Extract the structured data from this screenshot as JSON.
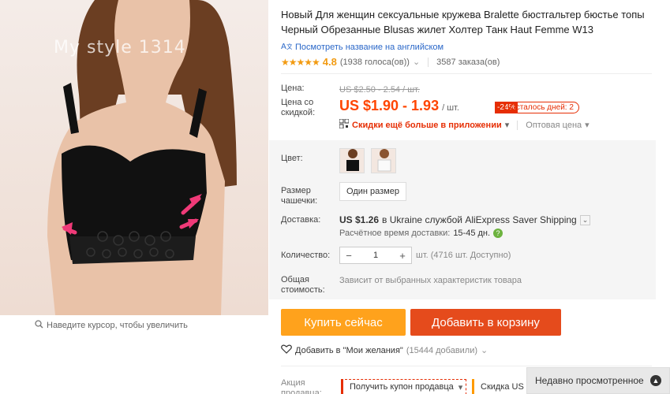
{
  "gallery": {
    "watermark": "My style 1314",
    "zoom_hint": "Наведите курсор, чтобы увеличить"
  },
  "product": {
    "title": "Новый Для женщин сексуальные кружева Bralette бюстгальтер бюстье топы Черный Обрезанные Blusas жилет Холтер Танк Haut Femme W13",
    "translate_link": "Посмотреть название на английском",
    "stars": "★★★★★",
    "rating": "4.8",
    "votes": "(1938 голоса(ов))",
    "orders": "3587 заказа(ов)"
  },
  "price": {
    "label": "Цена:",
    "old": "US $2.50 - 2.54 / шт.",
    "discount_label": "Цена со скидкой:",
    "new": "US $1.90 - 1.93",
    "unit": "/ шт.",
    "discount": "-24%",
    "days_left": "Осталось дней: 2",
    "app_link": "Скидки ещё больше в приложении",
    "wholesale": "Оптовая цена"
  },
  "props": {
    "color_label": "Цвет:",
    "size_label": "Размер чашечки:",
    "size_value": "Один размер",
    "delivery_label": "Доставка:",
    "shipping_price": "US $1.26",
    "shipping_text": "в Ukraine службой AliExpress Saver Shipping",
    "delivery_time_label": "Расчётное время доставки:",
    "delivery_time": "15-45 дн.",
    "qty_label": "Количество:",
    "qty_value": "1",
    "qty_available": "шт. (4716 шт. Доступно)",
    "total_label": "Общая стоимость:",
    "total_value": "Зависит от выбранных характеристик товара"
  },
  "actions": {
    "buy": "Купить сейчас",
    "cart": "Добавить в корзину",
    "wishlist": "Добавить в \"Мои желания\"",
    "wishlist_count": "(15444 добавили)"
  },
  "promo": {
    "label": "Акция продавца:",
    "coupon": "Получить купон продавца",
    "coupon2": "Скидка US $"
  },
  "recent": {
    "label": "Недавно просмотренное"
  },
  "colors": {
    "accent": "#ff4500",
    "buy": "#ffa21c",
    "cart": "#e54b1c",
    "link": "#2a67c8",
    "star": "#f29b12"
  }
}
